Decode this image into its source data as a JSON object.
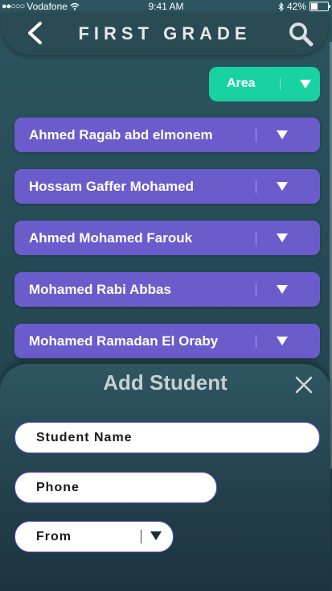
{
  "status_bar": {
    "signal": "●●○○○",
    "carrier": "Vodafone",
    "time": "9:41 AM",
    "battery": "42%",
    "battery_level": 0.42
  },
  "header": {
    "title": "FIRST GRADE"
  },
  "area_dropdown": {
    "label": "Area"
  },
  "students": [
    {
      "name": "Ahmed Ragab abd elmonem"
    },
    {
      "name": "Hossam Gaffer Mohamed"
    },
    {
      "name": "Ahmed Mohamed Farouk"
    },
    {
      "name": "Mohamed Rabi Abbas"
    },
    {
      "name": "Mohamed Ramadan El Oraby"
    }
  ],
  "add_student": {
    "title": "Add Student",
    "name_placeholder": "Student Name",
    "phone_placeholder": "Phone",
    "from_label": "From"
  },
  "colors": {
    "accent_green": "#18d2a2",
    "row_purple": "#6b5ccc",
    "background": "#264a55"
  }
}
